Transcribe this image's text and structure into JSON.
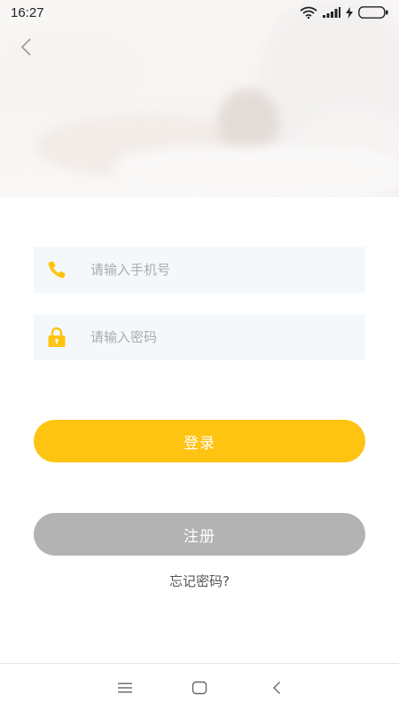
{
  "status_bar": {
    "time": "16:27",
    "icons": [
      "wifi-icon",
      "signal-icon",
      "charging-icon",
      "battery-icon"
    ]
  },
  "header": {
    "back_icon": "chevron-left-icon"
  },
  "form": {
    "phone": {
      "icon": "phone-icon",
      "placeholder": "请输入手机号",
      "value": ""
    },
    "password": {
      "icon": "lock-icon",
      "placeholder": "请输入密码",
      "value": ""
    }
  },
  "actions": {
    "login_label": "登录",
    "register_label": "注册",
    "forgot_label": "忘记密码?"
  },
  "system_nav": {
    "buttons": [
      "menu-icon",
      "home-icon",
      "back-icon"
    ]
  },
  "colors": {
    "accent": "#ffc312",
    "register_bg": "#b3b3b3",
    "field_bg": "#f5f8fb",
    "placeholder": "#a8acb2"
  }
}
